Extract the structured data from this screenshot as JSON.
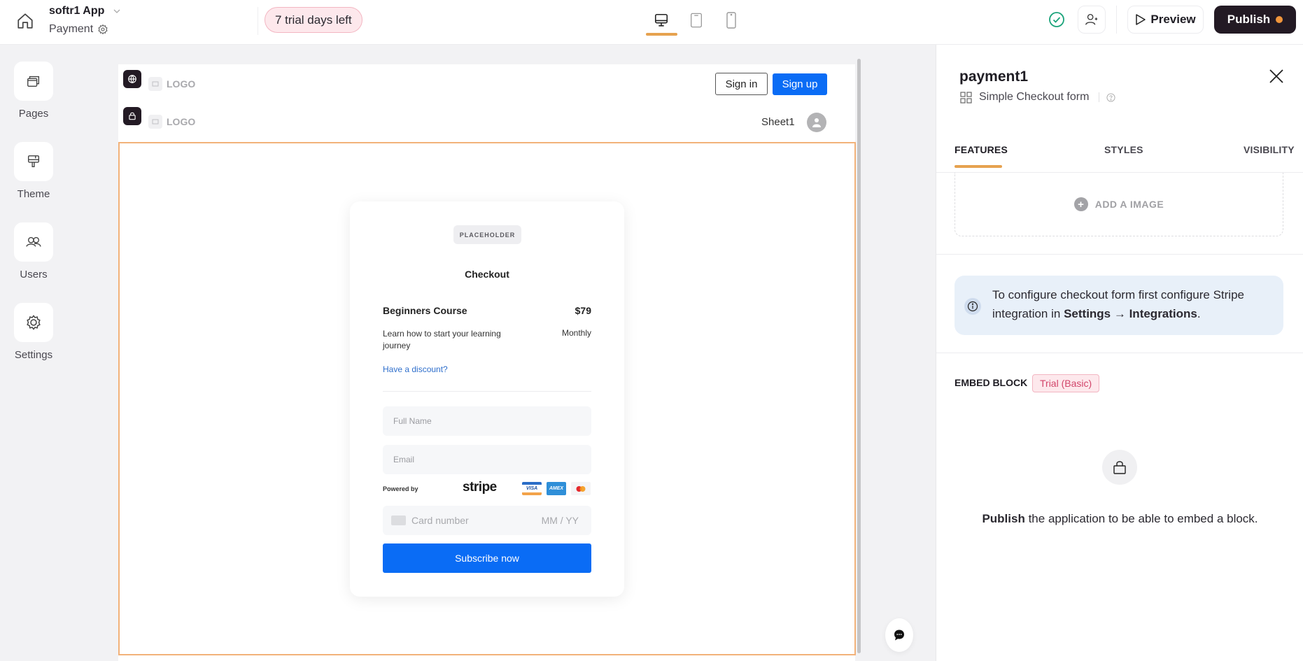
{
  "topbar": {
    "app_name": "softr1 App",
    "page_name": "Payment",
    "trial_badge": "7 trial days left",
    "devices": [
      "desktop",
      "tablet",
      "mobile"
    ],
    "active_device": "desktop",
    "preview_label": "Preview",
    "publish_label": "Publish"
  },
  "rail": {
    "items": [
      {
        "label": "Pages",
        "icon": "pages-icon"
      },
      {
        "label": "Theme",
        "icon": "paint-roller-icon"
      },
      {
        "label": "Users",
        "icon": "users-icon"
      },
      {
        "label": "Settings",
        "icon": "gear-icon"
      }
    ]
  },
  "canvas": {
    "header1": {
      "logo": "LOGO",
      "signin": "Sign in",
      "signup": "Sign up"
    },
    "header2": {
      "logo": "LOGO",
      "user_label": "Sheet1"
    },
    "checkout": {
      "placeholder": "PLACEHOLDER",
      "title": "Checkout",
      "product_name": "Beginners Course",
      "price": "$79",
      "description": "Learn how to start your learning journey",
      "interval": "Monthly",
      "discount_link": "Have a discount?",
      "fullname_placeholder": "Full Name",
      "email_placeholder": "Email",
      "powered_by": "Powered by",
      "stripe": "stripe",
      "brands": [
        "VISA",
        "AMEX",
        "Mastercard"
      ],
      "card_number_placeholder": "Card number",
      "expiry_placeholder": "MM / YY",
      "subscribe_label": "Subscribe now"
    }
  },
  "panel": {
    "title": "payment1",
    "block_type": "Simple Checkout form",
    "tabs": [
      {
        "label": "FEATURES",
        "active": true
      },
      {
        "label": "STYLES",
        "active": false
      },
      {
        "label": "VISIBILITY",
        "active": false
      }
    ],
    "add_image_label": "ADD A IMAGE",
    "info": {
      "text_before": "To configure checkout form first configure Stripe integration in ",
      "text_bold": "Settings → Integrations",
      "text_after": "."
    },
    "embed": {
      "label": "EMBED BLOCK",
      "badge": "Trial (Basic)",
      "msg_bold": "Publish",
      "msg_rest": " the application to be able to embed a block."
    }
  },
  "colors": {
    "accent": "#e6a24f",
    "primary_blue": "#0a6cf5",
    "publish_bg": "#231a24",
    "publish_dot": "#f0953b",
    "trial_bg": "#fde8ec",
    "trial_text": "#d2456a",
    "success": "#1aa37a"
  }
}
